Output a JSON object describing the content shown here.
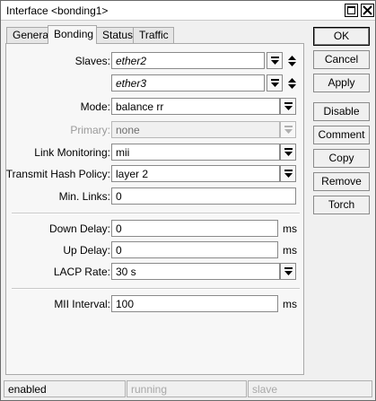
{
  "window": {
    "title": "Interface <bonding1>"
  },
  "tabs": [
    {
      "label": "General"
    },
    {
      "label": "Bonding"
    },
    {
      "label": "Status"
    },
    {
      "label": "Traffic"
    }
  ],
  "active_tab": "Bonding",
  "form": {
    "slaves_label": "Slaves:",
    "slaves": [
      "ether2",
      "ether3"
    ],
    "mode_label": "Mode:",
    "mode_value": "balance rr",
    "primary_label": "Primary:",
    "primary_value": "none",
    "link_monitoring_label": "Link Monitoring:",
    "link_monitoring_value": "mii",
    "hash_policy_label": "Transmit Hash Policy:",
    "hash_policy_value": "layer 2",
    "min_links_label": "Min. Links:",
    "min_links_value": "0",
    "down_delay_label": "Down Delay:",
    "down_delay_value": "0",
    "down_delay_unit": "ms",
    "up_delay_label": "Up Delay:",
    "up_delay_value": "0",
    "up_delay_unit": "ms",
    "lacp_rate_label": "LACP Rate:",
    "lacp_rate_value": "30 s",
    "mii_interval_label": "MII Interval:",
    "mii_interval_value": "100",
    "mii_interval_unit": "ms"
  },
  "buttons": {
    "ok": "OK",
    "cancel": "Cancel",
    "apply": "Apply",
    "disable": "Disable",
    "comment": "Comment",
    "copy": "Copy",
    "remove": "Remove",
    "torch": "Torch"
  },
  "status_bar": {
    "state": "enabled",
    "running": "running",
    "slave": "slave"
  },
  "icons": {
    "dropdown": "dropdown-arrow-icon",
    "updown": "up-down-arrows-icon",
    "restore": "restore-icon",
    "close": "close-icon"
  }
}
